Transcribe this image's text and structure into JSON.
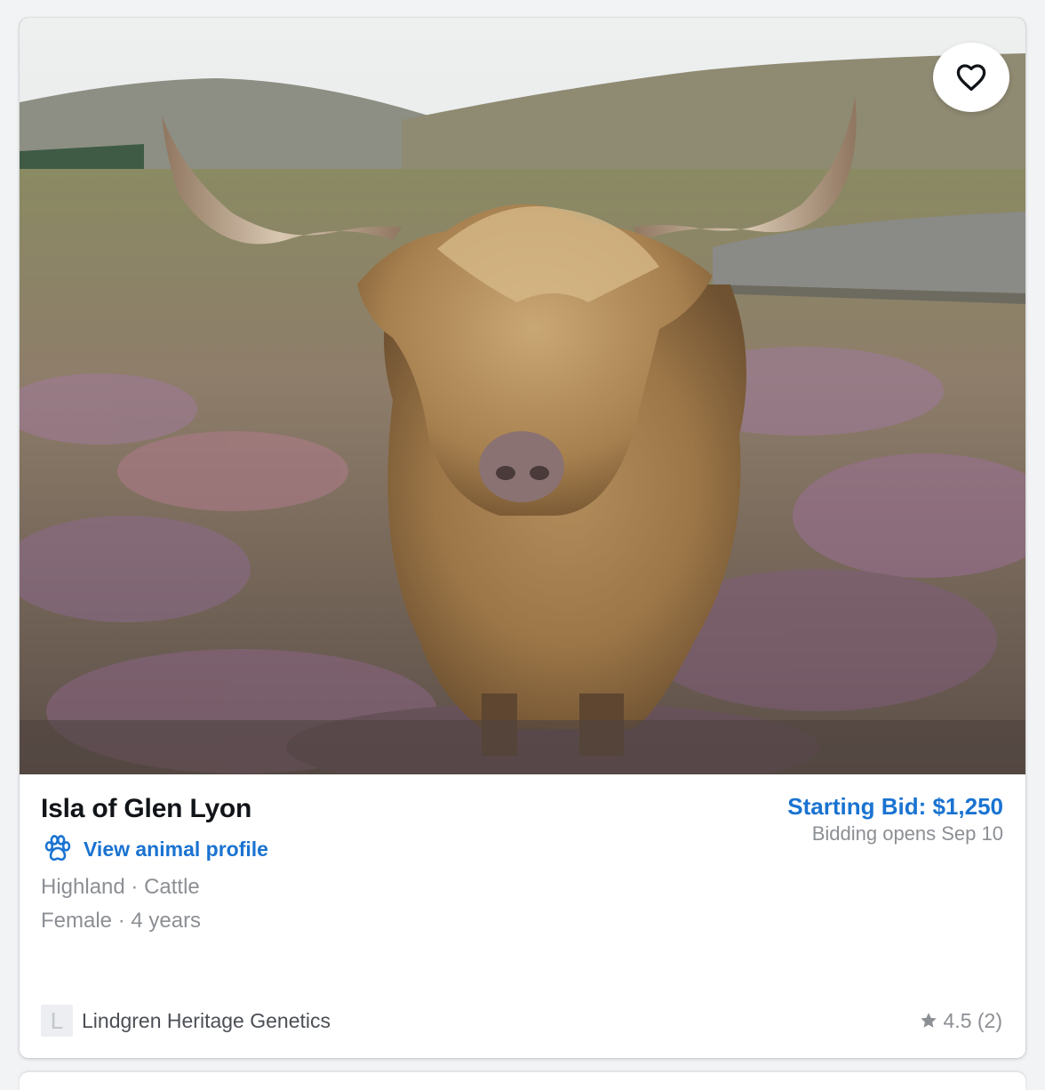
{
  "listing": {
    "name": "Isla of Glen Lyon",
    "profile_link": "View animal profile",
    "breed_species": "Highland · Cattle",
    "sex_age": "Female · 4 years",
    "starting_bid": "Starting Bid: $1,250",
    "bidding_opens": "Bidding opens Sep 10",
    "seller_initial": "L",
    "seller_name": "Lindgren Heritage Genetics",
    "rating": "4.5 (2)",
    "image_alt": "Highland cow"
  },
  "icons": {
    "favorite": "heart-outline-icon",
    "profile": "paw-icon",
    "rating": "star-icon"
  },
  "colors": {
    "accent": "#1a73d1",
    "muted_text": "#8c8f94",
    "title_text": "#111418"
  }
}
